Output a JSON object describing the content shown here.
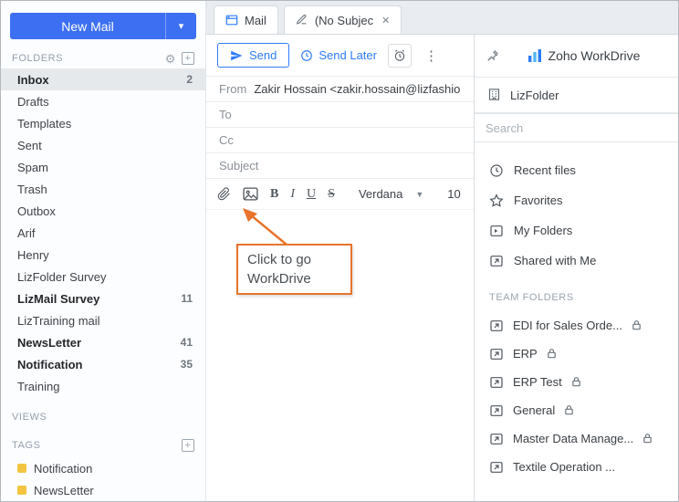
{
  "sidebar": {
    "new_mail_label": "New Mail",
    "folders_label": "FOLDERS",
    "folders": [
      {
        "label": "Inbox",
        "count": "2"
      },
      {
        "label": "Drafts"
      },
      {
        "label": "Templates"
      },
      {
        "label": "Sent"
      },
      {
        "label": "Spam"
      },
      {
        "label": "Trash"
      },
      {
        "label": "Outbox"
      },
      {
        "label": "Arif"
      },
      {
        "label": "Henry"
      },
      {
        "label": "LizFolder Survey"
      },
      {
        "label": "LizMail Survey",
        "count": "11"
      },
      {
        "label": "LizTraining mail"
      },
      {
        "label": "NewsLetter",
        "count": "41"
      },
      {
        "label": "Notification",
        "count": "35"
      },
      {
        "label": "Training"
      }
    ],
    "views_label": "VIEWS",
    "tags_label": "TAGS",
    "tags": [
      {
        "label": "Notification",
        "color": "#f3c440"
      },
      {
        "label": "NewsLetter",
        "color": "#f3c440"
      }
    ]
  },
  "tabs": [
    {
      "label": "Mail"
    },
    {
      "label": "(No Subjec"
    }
  ],
  "compose": {
    "send_label": "Send",
    "send_later_label": "Send Later",
    "from_label": "From",
    "from_value": "Zakir Hossain <zakir.hossain@lizfashion.org>",
    "to_label": "To",
    "cc_label": "Cc",
    "subject_label": "Subject",
    "bold_label": "B",
    "italic_label": "I",
    "underline_label": "U",
    "strike_label": "S",
    "font_family_value": "Verdana",
    "font_size_value": "10"
  },
  "callout": {
    "text": "Click to go WorkDrive",
    "border_color": "#e8742c"
  },
  "workdrive": {
    "title": "Zoho WorkDrive",
    "folder_name": "LizFolder",
    "search_placeholder": "Search",
    "nav": [
      {
        "label": "Recent files",
        "icon": "clock-icon"
      },
      {
        "label": "Favorites",
        "icon": "star-icon"
      },
      {
        "label": "My Folders",
        "icon": "my-folders-icon"
      },
      {
        "label": "Shared with Me",
        "icon": "shared-icon"
      }
    ],
    "team_folders_label": "TEAM FOLDERS",
    "team_folders": [
      {
        "label": "EDI for Sales Orde...",
        "locked": true
      },
      {
        "label": "ERP",
        "locked": true
      },
      {
        "label": "ERP Test",
        "locked": true
      },
      {
        "label": "General",
        "locked": true
      },
      {
        "label": "Master Data Manage...",
        "locked": true
      },
      {
        "label": "Textile Operation ...",
        "locked": false
      }
    ]
  },
  "colors": {
    "accent_blue": "#2e7cf6",
    "new_mail_blue": "#3d6ff2",
    "callout_orange": "#e8742c",
    "tag_yellow": "#f3c440"
  }
}
